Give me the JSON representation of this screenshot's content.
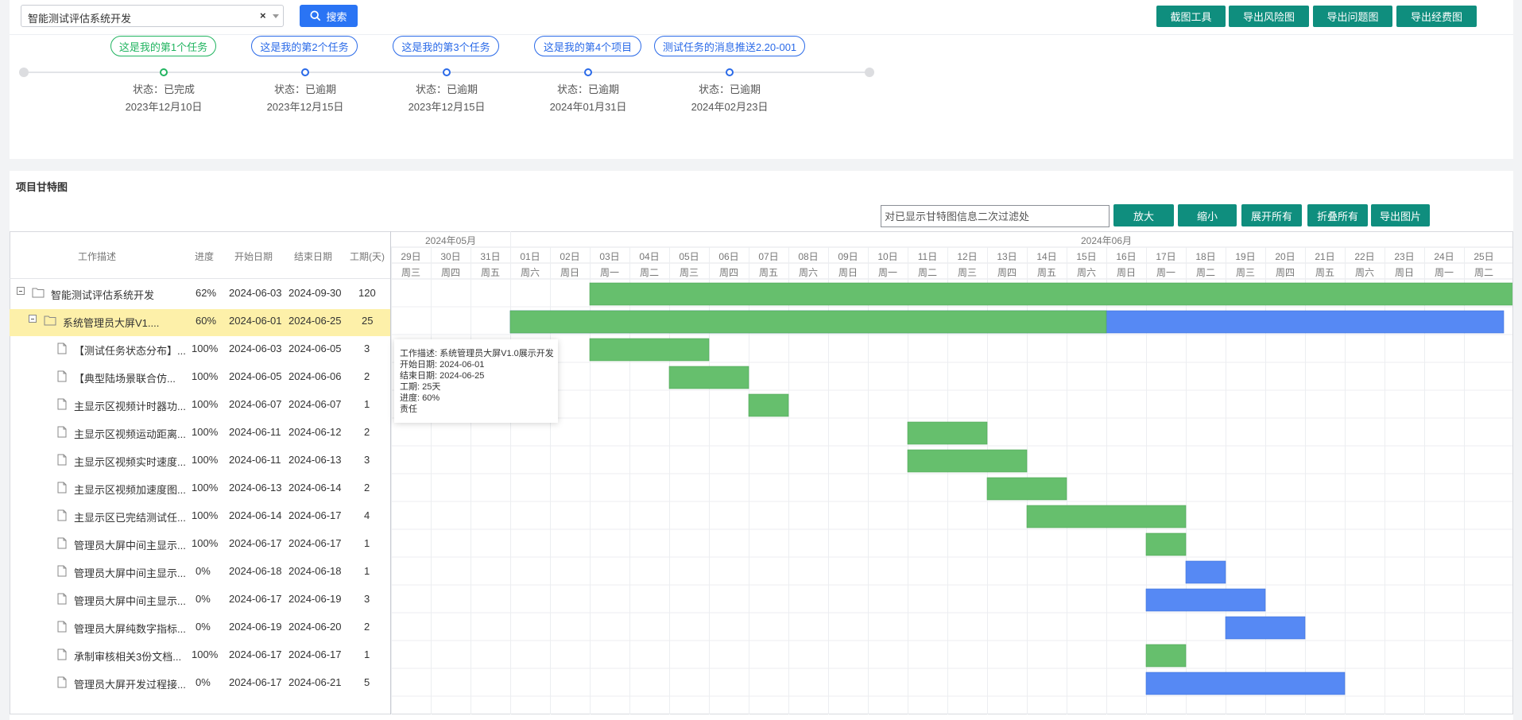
{
  "header": {
    "project_select": "智能测试评估系统开发",
    "clear_glyph": "×",
    "search_label": "搜索",
    "actions": [
      {
        "label": "截图工具"
      },
      {
        "label": "导出风险图"
      },
      {
        "label": "导出问题图"
      },
      {
        "label": "导出经费图"
      }
    ]
  },
  "timeline": [
    {
      "title": "这是我的第1个任务",
      "status": "状态：已完成",
      "date": "2023年12月10日",
      "done": true
    },
    {
      "title": "这是我的第2个任务",
      "status": "状态：已逾期",
      "date": "2023年12月15日",
      "done": false
    },
    {
      "title": "这是我的第3个任务",
      "status": "状态：已逾期",
      "date": "2023年12月15日",
      "done": false
    },
    {
      "title": "这是我的第4个项目",
      "status": "状态：已逾期",
      "date": "2024年01月31日",
      "done": false
    },
    {
      "title": "测试任务的消息推送2.20-001",
      "status": "状态：已逾期",
      "date": "2024年02月23日",
      "done": false
    }
  ],
  "gantt": {
    "title": "项目甘特图",
    "filter_placeholder": "对已显示甘特图信息二次过滤处",
    "buttons": [
      {
        "label": "放大"
      },
      {
        "label": "缩小"
      },
      {
        "label": "展开所有"
      },
      {
        "label": "折叠所有"
      },
      {
        "label": "导出图片"
      }
    ],
    "columns": [
      "工作描述",
      "进度",
      "开始日期",
      "结束日期",
      "工期(天)"
    ],
    "month_labels": [
      "2024年05月",
      "2024年06月"
    ],
    "days": [
      {
        "d": "29日",
        "w": "周三"
      },
      {
        "d": "30日",
        "w": "周四"
      },
      {
        "d": "31日",
        "w": "周五"
      },
      {
        "d": "01日",
        "w": "周六"
      },
      {
        "d": "02日",
        "w": "周日"
      },
      {
        "d": "03日",
        "w": "周一"
      },
      {
        "d": "04日",
        "w": "周二"
      },
      {
        "d": "05日",
        "w": "周三"
      },
      {
        "d": "06日",
        "w": "周四"
      },
      {
        "d": "07日",
        "w": "周五"
      },
      {
        "d": "08日",
        "w": "周六"
      },
      {
        "d": "09日",
        "w": "周日"
      },
      {
        "d": "10日",
        "w": "周一"
      },
      {
        "d": "11日",
        "w": "周二"
      },
      {
        "d": "12日",
        "w": "周三"
      },
      {
        "d": "13日",
        "w": "周四"
      },
      {
        "d": "14日",
        "w": "周五"
      },
      {
        "d": "15日",
        "w": "周六"
      },
      {
        "d": "16日",
        "w": "周日"
      },
      {
        "d": "17日",
        "w": "周一"
      },
      {
        "d": "18日",
        "w": "周二"
      },
      {
        "d": "19日",
        "w": "周三"
      },
      {
        "d": "20日",
        "w": "周四"
      },
      {
        "d": "21日",
        "w": "周五"
      },
      {
        "d": "22日",
        "w": "周六"
      },
      {
        "d": "23日",
        "w": "周日"
      },
      {
        "d": "24日",
        "w": "周一"
      },
      {
        "d": "25日",
        "w": "周二"
      }
    ],
    "rows": [
      {
        "name": "智能测试评估系统开发",
        "progress": "62%",
        "start": "2024-06-03",
        "end": "2024-09-30",
        "days": "120",
        "level": 0,
        "type": "folder",
        "bar_start": "2024-06-03",
        "bar_end": "2024-09-30",
        "done_frac": 1.0
      },
      {
        "name": "系统管理员大屏V1....",
        "progress": "60%",
        "start": "2024-06-01",
        "end": "2024-06-25",
        "days": "25",
        "level": 1,
        "type": "folder",
        "bar_start": "2024-06-01",
        "bar_end": "2024-06-25",
        "done_frac": 0.6
      },
      {
        "name": "【测试任务状态分布】...",
        "progress": "100%",
        "start": "2024-06-03",
        "end": "2024-06-05",
        "days": "3",
        "level": 2,
        "type": "file",
        "bar_start": "2024-06-03",
        "bar_end": "2024-06-05",
        "done_frac": 1.0
      },
      {
        "name": "【典型陆场景联合仿...",
        "progress": "100%",
        "start": "2024-06-05",
        "end": "2024-06-06",
        "days": "2",
        "level": 2,
        "type": "file",
        "bar_start": "2024-06-05",
        "bar_end": "2024-06-06",
        "done_frac": 1.0
      },
      {
        "name": "主显示区视频计时器功...",
        "progress": "100%",
        "start": "2024-06-07",
        "end": "2024-06-07",
        "days": "1",
        "level": 2,
        "type": "file",
        "bar_start": "2024-06-07",
        "bar_end": "2024-06-07",
        "done_frac": 1.0
      },
      {
        "name": "主显示区视频运动距离...",
        "progress": "100%",
        "start": "2024-06-11",
        "end": "2024-06-12",
        "days": "2",
        "level": 2,
        "type": "file",
        "bar_start": "2024-06-11",
        "bar_end": "2024-06-12",
        "done_frac": 1.0
      },
      {
        "name": "主显示区视频实时速度...",
        "progress": "100%",
        "start": "2024-06-11",
        "end": "2024-06-13",
        "days": "3",
        "level": 2,
        "type": "file",
        "bar_start": "2024-06-11",
        "bar_end": "2024-06-13",
        "done_frac": 1.0
      },
      {
        "name": "主显示区视频加速度图...",
        "progress": "100%",
        "start": "2024-06-13",
        "end": "2024-06-14",
        "days": "2",
        "level": 2,
        "type": "file",
        "bar_start": "2024-06-13",
        "bar_end": "2024-06-14",
        "done_frac": 1.0
      },
      {
        "name": "主显示区已完结测试任...",
        "progress": "100%",
        "start": "2024-06-14",
        "end": "2024-06-17",
        "days": "4",
        "level": 2,
        "type": "file",
        "bar_start": "2024-06-14",
        "bar_end": "2024-06-17",
        "done_frac": 1.0
      },
      {
        "name": "管理员大屏中间主显示...",
        "progress": "100%",
        "start": "2024-06-17",
        "end": "2024-06-17",
        "days": "1",
        "level": 2,
        "type": "file",
        "bar_start": "2024-06-17",
        "bar_end": "2024-06-17",
        "done_frac": 1.0
      },
      {
        "name": "管理员大屏中间主显示...",
        "progress": "0%",
        "start": "2024-06-18",
        "end": "2024-06-18",
        "days": "1",
        "level": 2,
        "type": "file",
        "bar_start": "2024-06-18",
        "bar_end": "2024-06-18",
        "done_frac": 0.0
      },
      {
        "name": "管理员大屏中间主显示...",
        "progress": "0%",
        "start": "2024-06-17",
        "end": "2024-06-19",
        "days": "3",
        "level": 2,
        "type": "file",
        "bar_start": "2024-06-17",
        "bar_end": "2024-06-19",
        "done_frac": 0.0
      },
      {
        "name": "管理员大屏纯数字指标...",
        "progress": "0%",
        "start": "2024-06-19",
        "end": "2024-06-20",
        "days": "2",
        "level": 2,
        "type": "file",
        "bar_start": "2024-06-19",
        "bar_end": "2024-06-20",
        "done_frac": 0.0
      },
      {
        "name": "承制审核相关3份文档...",
        "progress": "100%",
        "start": "2024-06-17",
        "end": "2024-06-17",
        "days": "1",
        "level": 2,
        "type": "file",
        "bar_start": "2024-06-17",
        "bar_end": "2024-06-17",
        "done_frac": 1.0
      },
      {
        "name": "管理员大屏开发过程接...",
        "progress": "0%",
        "start": "2024-06-17",
        "end": "2024-06-21",
        "days": "5",
        "level": 2,
        "type": "file",
        "bar_start": "2024-06-17",
        "bar_end": "2024-06-21",
        "done_frac": 0.0
      }
    ],
    "colors": {
      "done": "#66bf6d",
      "todo": "#5689f4",
      "highlight": "#fdf0a9"
    },
    "tooltip": {
      "desc": "工作描述: 系统管理员大屏V1.0展示开发",
      "start": "开始日期: 2024-06-01",
      "end": "结束日期: 2024-06-25",
      "duration": "工期: 25天",
      "progress": "进度: 60%",
      "owner": "责任"
    }
  }
}
